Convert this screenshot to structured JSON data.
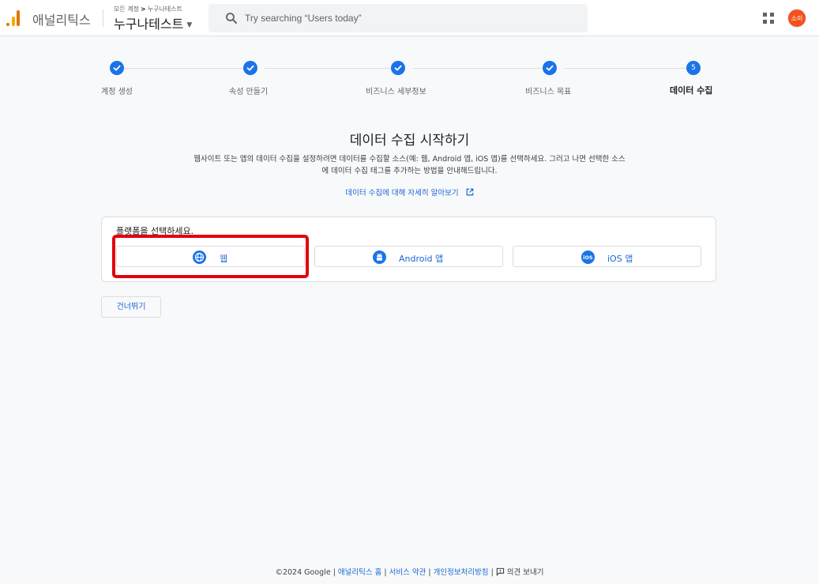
{
  "header": {
    "app_name": "애널리틱스",
    "breadcrumb_root": "모든 계정",
    "breadcrumb_sep": ">",
    "breadcrumb_account": "누구나테스트",
    "property_name": "누구나테스트",
    "search_placeholder": "Try searching “Users today”",
    "avatar_initials": "소미",
    "icons": {
      "search": "search-icon",
      "apps": "apps-grid-icon",
      "caret": "caret-down-icon"
    }
  },
  "stepper": {
    "steps": [
      {
        "label": "계정 생성",
        "state": "done"
      },
      {
        "label": "속성 만들기",
        "state": "done"
      },
      {
        "label": "비즈니스 세부정보",
        "state": "done"
      },
      {
        "label": "비즈니스 목표",
        "state": "done"
      },
      {
        "label": "데이터 수집",
        "state": "active",
        "number": "5"
      }
    ]
  },
  "intro": {
    "title": "데이터 수집 시작하기",
    "desc_line1": "웹사이트 또는 앱의 데이터 수집을 설정하려면 데이터를 수집할 소스(예: 웹, Android 앱, iOS 앱)를 선택하세요. 그러고 나면 선택한 소스",
    "desc_line2": "에 데이터 수집 태그를 추가하는 방법을 안내해드립니다.",
    "learn_more": "데이터 수집에 대해 자세히 알아보기"
  },
  "platform": {
    "prompt": "플랫폼을 선택하세요.",
    "options": [
      {
        "label": "웹",
        "icon": "globe-icon"
      },
      {
        "label": "Android 앱",
        "icon": "android-icon"
      },
      {
        "label": "iOS 앱",
        "icon": "ios-icon"
      }
    ]
  },
  "skip_label": "건너뛰기",
  "footer": {
    "copyright": "©2024 Google",
    "sep": " | ",
    "home": "애널리틱스 홈",
    "terms": "서비스 약관",
    "privacy": "개인정보처리방침",
    "feedback": "의견 보내기"
  },
  "colors": {
    "accent": "#1a73e8",
    "link": "#1967d2",
    "highlight": "#e3000f",
    "avatar": "#f4511e"
  }
}
